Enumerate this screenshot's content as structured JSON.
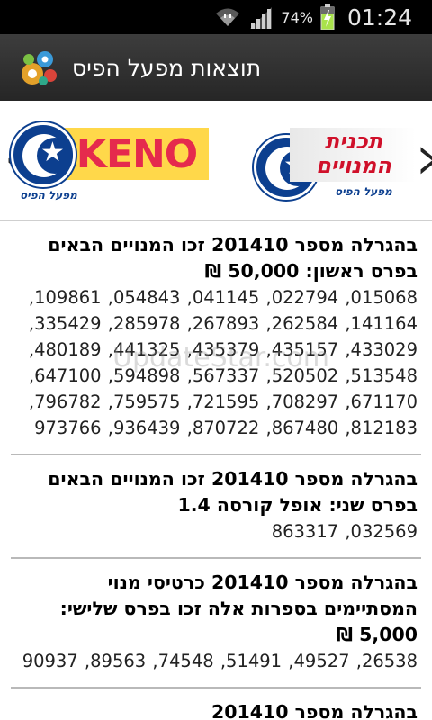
{
  "status_bar": {
    "battery_percent": "74%",
    "time": "01:24"
  },
  "app_bar": {
    "title": "תוצאות מפעל הפיס"
  },
  "banner": {
    "keno_label": "KENO",
    "keno_caption": "מפעל הפיס",
    "menuim_label": "תכנית המנויים",
    "menuim_caption": "מפעל הפיס"
  },
  "results": [
    {
      "title": "בהגרלה מספר 201410 זכו המנויים הבאים בפרס ראשון: 50,000 ₪",
      "numbers": "015068, 022794, 041145, 054843, 109861, 141164, 262584, 267893, 285978, 335429, 433029, 435157, 435379, 441325, 480189, 513548, 520502, 567337, 594898, 647100, 671170, 708297, 721595, 759575, 796782, 812183, 867480, 870722, 936439, 973766"
    },
    {
      "title": "בהגרלה מספר 201410 זכו המנויים הבאים בפרס שני: אופל קורסה 1.4",
      "numbers": "032569, 863317"
    },
    {
      "title": "בהגרלה מספר 201410 כרטיסי מנוי המסתיימים בספרות אלה זכו בפרס שלישי: 5,000 ₪",
      "numbers": "26538, 49527, 51491, 74548, 89563, 90937"
    },
    {
      "title": "בהגרלה מספר 201410",
      "numbers": ""
    }
  ],
  "watermark": "UpdateStar.com",
  "colors": {
    "status_bar_bg": "#000000",
    "action_bar_bg": "#2e2e2e",
    "keno_yellow": "#ffd84a",
    "keno_red": "#e52a4d",
    "emblem_blue": "#0c3f8f",
    "menuim_red": "#d0102a",
    "divider": "#b9b9b9"
  }
}
